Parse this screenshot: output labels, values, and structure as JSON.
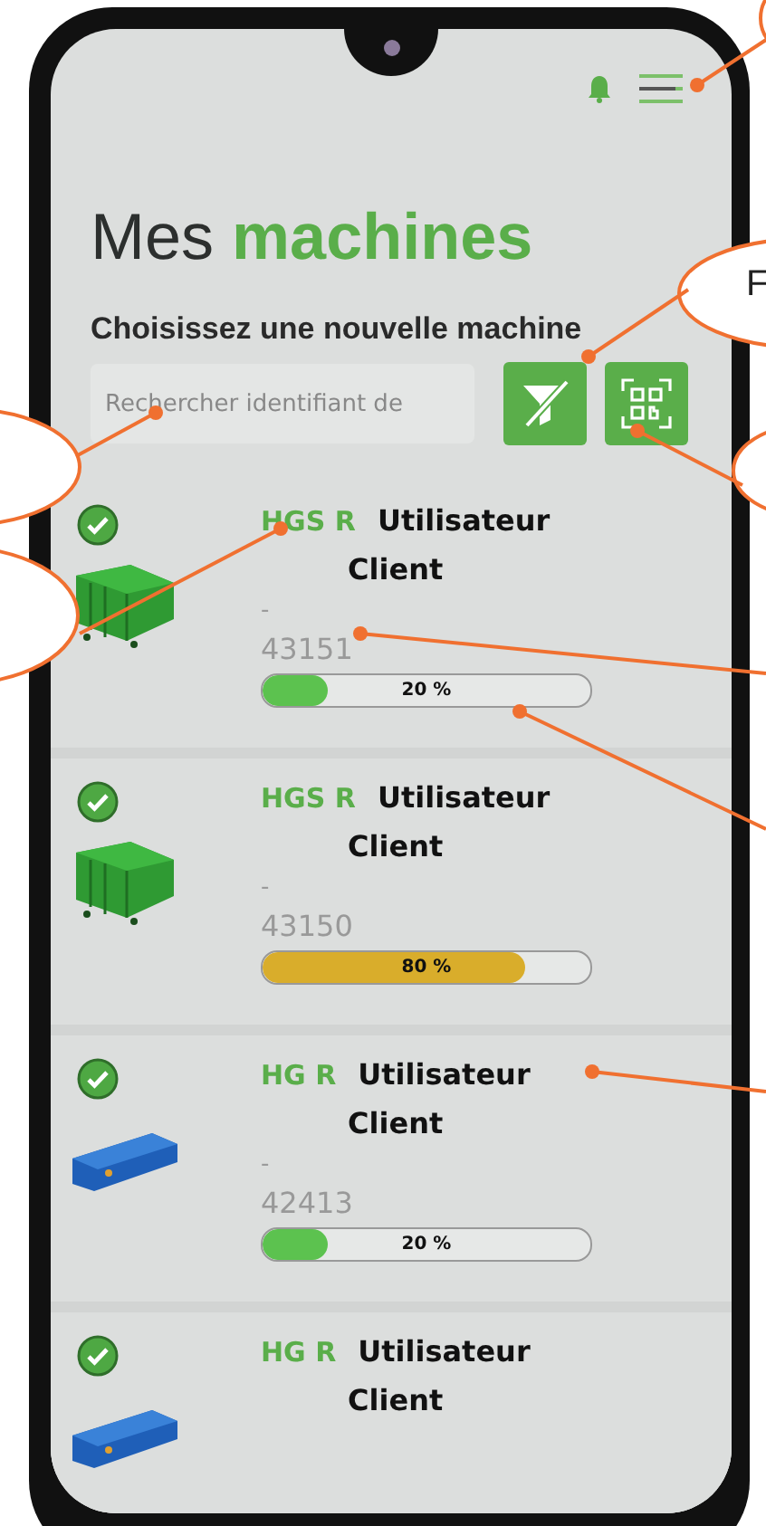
{
  "title": {
    "plain": "Mes",
    "accent": "machines"
  },
  "subtitle": "Choisissez une nouvelle machine",
  "search": {
    "placeholder": "Rechercher identifiant de"
  },
  "machines": [
    {
      "model": "HGS R",
      "user": "Utilisateur",
      "client": "Client",
      "dash": "-",
      "id": "43151",
      "kind": "compactor",
      "progress": {
        "level": 0.2,
        "label": "20 %",
        "color": "#5cc24f"
      }
    },
    {
      "model": "HGS R",
      "user": "Utilisateur",
      "client": "Client",
      "dash": "-",
      "id": "43150",
      "kind": "compactor",
      "progress": {
        "level": 0.8,
        "label": "80 %",
        "color": "#d9ad2b"
      }
    },
    {
      "model": "HG R",
      "user": "Utilisateur",
      "client": "Client",
      "dash": "-",
      "id": "42413",
      "kind": "press",
      "progress": {
        "level": 0.2,
        "label": "20 %",
        "color": "#5cc24f"
      }
    },
    {
      "model": "HG R",
      "user": "Utilisateur",
      "client": "Client",
      "kind": "press"
    }
  ],
  "callouts": [
    {
      "text": "F"
    }
  ]
}
